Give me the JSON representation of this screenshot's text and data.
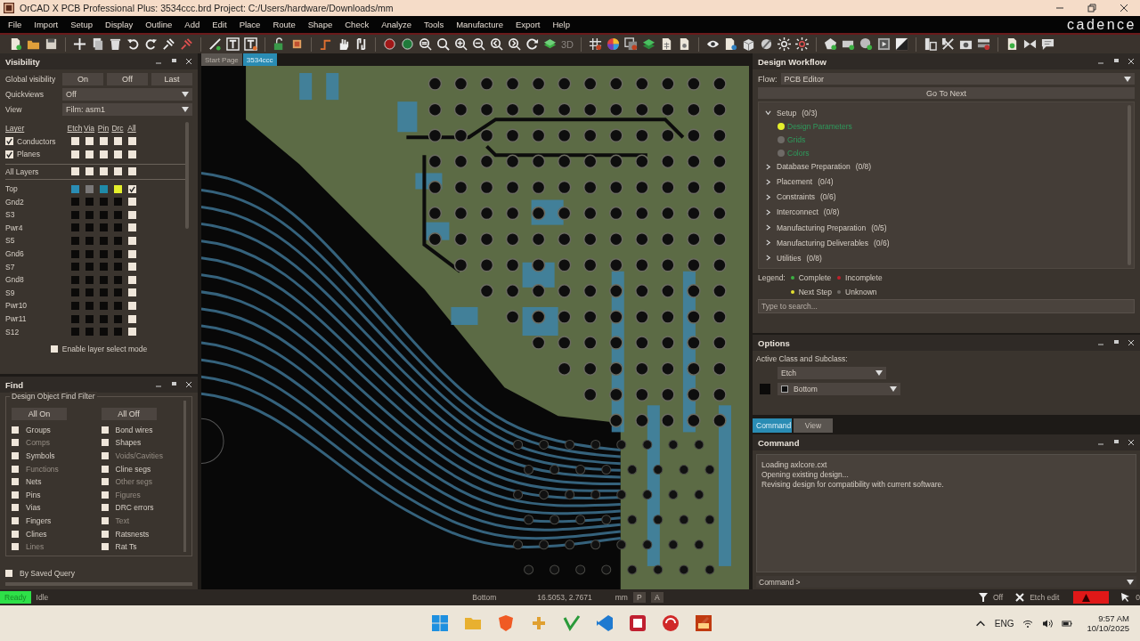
{
  "window": {
    "title": "OrCAD X PCB Professional Plus: 3534ccc.brd  Project: C:/Users/hardware/Downloads/mm"
  },
  "menu": [
    "File",
    "Import",
    "Setup",
    "Display",
    "Outline",
    "Add",
    "Edit",
    "Place",
    "Route",
    "Shape",
    "Check",
    "Analyze",
    "Tools",
    "Manufacture",
    "Export",
    "Help"
  ],
  "brand": "cadence",
  "toolbar": {
    "view_3d_label": "3D"
  },
  "visibility": {
    "title": "Visibility",
    "global_label": "Global visibility",
    "global_buttons": [
      "On",
      "Off",
      "Last"
    ],
    "quickviews": {
      "label": "Quickviews",
      "value": "Off"
    },
    "view": {
      "label": "View",
      "value": "Film: asm1"
    },
    "columns": [
      "Layer",
      "Etch",
      "Via",
      "Pin",
      "Drc",
      "All"
    ],
    "groups": [
      {
        "name": "Conductors",
        "checked": true,
        "cells": [
          {
            "checked": false
          },
          {
            "checked": false
          },
          {
            "checked": false
          },
          {
            "checked": false
          },
          {
            "checked": false
          }
        ]
      },
      {
        "name": "Planes",
        "checked": true,
        "cells": [
          {
            "checked": false
          },
          {
            "checked": false
          },
          {
            "checked": false
          },
          {
            "checked": false
          },
          {
            "checked": false
          }
        ]
      }
    ],
    "all_layers_label": "All Layers",
    "all_layers_cells": [
      {
        "checked": false
      },
      {
        "checked": false
      },
      {
        "checked": false
      },
      {
        "checked": false
      },
      {
        "checked": false
      }
    ],
    "layers": [
      {
        "name": "Top",
        "cells": [
          {
            "color": "#2a8cb4"
          },
          {
            "color": "#7a7878"
          },
          {
            "color": "#1f8aa8"
          },
          {
            "color": "#e4ef2c"
          }
        ],
        "all_checked": true
      },
      {
        "name": "Gnd2",
        "cells": [
          {
            "color": "#0b0a09"
          },
          {
            "color": "#0b0a09"
          },
          {
            "color": "#0b0a09"
          },
          {
            "color": "#0b0a09"
          }
        ],
        "all_checked": false
      },
      {
        "name": "S3",
        "cells": [
          {
            "color": "#0b0a09"
          },
          {
            "color": "#0b0a09"
          },
          {
            "color": "#0b0a09"
          },
          {
            "color": "#0b0a09"
          }
        ],
        "all_checked": false
      },
      {
        "name": "Pwr4",
        "cells": [
          {
            "color": "#0b0a09"
          },
          {
            "color": "#0b0a09"
          },
          {
            "color": "#0b0a09"
          },
          {
            "color": "#0b0a09"
          }
        ],
        "all_checked": false
      },
      {
        "name": "S5",
        "cells": [
          {
            "color": "#0b0a09"
          },
          {
            "color": "#0b0a09"
          },
          {
            "color": "#0b0a09"
          },
          {
            "color": "#0b0a09"
          }
        ],
        "all_checked": false
      },
      {
        "name": "Gnd6",
        "cells": [
          {
            "color": "#0b0a09"
          },
          {
            "color": "#0b0a09"
          },
          {
            "color": "#0b0a09"
          },
          {
            "color": "#0b0a09"
          }
        ],
        "all_checked": false
      },
      {
        "name": "S7",
        "cells": [
          {
            "color": "#0b0a09"
          },
          {
            "color": "#0b0a09"
          },
          {
            "color": "#0b0a09"
          },
          {
            "color": "#0b0a09"
          }
        ],
        "all_checked": false
      },
      {
        "name": "Gnd8",
        "cells": [
          {
            "color": "#0b0a09"
          },
          {
            "color": "#0b0a09"
          },
          {
            "color": "#0b0a09"
          },
          {
            "color": "#0b0a09"
          }
        ],
        "all_checked": false
      },
      {
        "name": "S9",
        "cells": [
          {
            "color": "#0b0a09"
          },
          {
            "color": "#0b0a09"
          },
          {
            "color": "#0b0a09"
          },
          {
            "color": "#0b0a09"
          }
        ],
        "all_checked": false
      },
      {
        "name": "Pwr10",
        "cells": [
          {
            "color": "#0b0a09"
          },
          {
            "color": "#0b0a09"
          },
          {
            "color": "#0b0a09"
          },
          {
            "color": "#0b0a09"
          }
        ],
        "all_checked": false
      },
      {
        "name": "Pwr11",
        "cells": [
          {
            "color": "#0b0a09"
          },
          {
            "color": "#0b0a09"
          },
          {
            "color": "#0b0a09"
          },
          {
            "color": "#0b0a09"
          }
        ],
        "all_checked": false
      },
      {
        "name": "S12",
        "cells": [
          {
            "color": "#0b0a09"
          },
          {
            "color": "#0b0a09"
          },
          {
            "color": "#0b0a09"
          },
          {
            "color": "#0b0a09"
          }
        ],
        "all_checked": false
      }
    ],
    "select_mode": {
      "label": "Enable layer select mode",
      "checked": false
    }
  },
  "find": {
    "title": "Find",
    "group_title": "Design Object Find Filter",
    "buttons": [
      "All On",
      "All Off"
    ],
    "left": [
      {
        "label": "Groups",
        "checked": false,
        "disabled": false
      },
      {
        "label": "Comps",
        "checked": false,
        "disabled": true
      },
      {
        "label": "Symbols",
        "checked": false,
        "disabled": false
      },
      {
        "label": "Functions",
        "checked": false,
        "disabled": true
      },
      {
        "label": "Nets",
        "checked": false,
        "disabled": false
      },
      {
        "label": "Pins",
        "checked": false,
        "disabled": false
      },
      {
        "label": "Vias",
        "checked": false,
        "disabled": false
      },
      {
        "label": "Fingers",
        "checked": false,
        "disabled": false
      },
      {
        "label": "Clines",
        "checked": false,
        "disabled": false
      },
      {
        "label": "Lines",
        "checked": false,
        "disabled": true
      }
    ],
    "right": [
      {
        "label": "Bond wires",
        "checked": false,
        "disabled": false
      },
      {
        "label": "Shapes",
        "checked": false,
        "disabled": false
      },
      {
        "label": "Voids/Cavities",
        "checked": false,
        "disabled": true
      },
      {
        "label": "Cline segs",
        "checked": false,
        "disabled": false
      },
      {
        "label": "Other segs",
        "checked": false,
        "disabled": true
      },
      {
        "label": "Figures",
        "checked": false,
        "disabled": true
      },
      {
        "label": "DRC errors",
        "checked": false,
        "disabled": false
      },
      {
        "label": "Text",
        "checked": false,
        "disabled": true
      },
      {
        "label": "Ratsnests",
        "checked": false,
        "disabled": false
      },
      {
        "label": "Rat Ts",
        "checked": false,
        "disabled": false
      }
    ],
    "saved_query": {
      "label": "By Saved Query",
      "checked": false
    }
  },
  "canvas_tabs": [
    {
      "label": "Start Page",
      "selected": false
    },
    {
      "label": "3534ccc",
      "selected": true
    }
  ],
  "workflow": {
    "title": "Design Workflow",
    "flow_label": "Flow:",
    "flow_value": "PCB Editor",
    "next_button": "Go To Next",
    "steps": [
      {
        "label": "Setup",
        "count": "(0/3)",
        "expanded": true,
        "children": [
          {
            "label": "Design Parameters",
            "color": "#e4ef2c"
          },
          {
            "label": "Grids",
            "color": "#6e6a66"
          },
          {
            "label": "Colors",
            "color": "#6e6a66"
          }
        ]
      },
      {
        "label": "Database Preparation",
        "count": "(0/8)",
        "expanded": false
      },
      {
        "label": "Placement",
        "count": "(0/4)",
        "expanded": false
      },
      {
        "label": "Constraints",
        "count": "(0/6)",
        "expanded": false
      },
      {
        "label": "Interconnect",
        "count": "(0/8)",
        "expanded": false
      },
      {
        "label": "Manufacturing Preparation",
        "count": "(0/5)",
        "expanded": false
      },
      {
        "label": "Manufacturing Deliverables",
        "count": "(0/6)",
        "expanded": false
      },
      {
        "label": "Utilities",
        "count": "(0/8)",
        "expanded": false
      }
    ],
    "legend_label": "Legend:",
    "legend": [
      {
        "label": "Complete",
        "color": "#3cb043"
      },
      {
        "label": "Incomplete",
        "color": "#c0202a"
      },
      {
        "label": "Next Step",
        "color": "#e4e030"
      },
      {
        "label": "Unknown",
        "color": "#6e6a66"
      }
    ],
    "search_placeholder": "Type to search..."
  },
  "options": {
    "title": "Options",
    "class_label": "Active Class and Subclass:",
    "class_value": "Etch",
    "subclass_value": "Bottom"
  },
  "bottom_tabs": [
    {
      "label": "Command",
      "selected": true
    },
    {
      "label": "View",
      "selected": false
    }
  ],
  "command": {
    "title": "Command",
    "lines": [
      "Loading axlcore.cxt",
      "Opening existing design...",
      "Revising design for compatibility with current software."
    ],
    "prompt": "Command >"
  },
  "status_bar": {
    "ready": "Ready",
    "idle": "Idle",
    "layer": "Bottom",
    "coords": "16.5053, 2.7671",
    "units": "mm",
    "p_button": "P",
    "a_button": "A",
    "filter": "Off",
    "mode": "Etch edit",
    "selected_count": "0"
  },
  "taskbar": {
    "language": "ENG",
    "time": "9:57 AM",
    "date": "10/10/2025"
  }
}
